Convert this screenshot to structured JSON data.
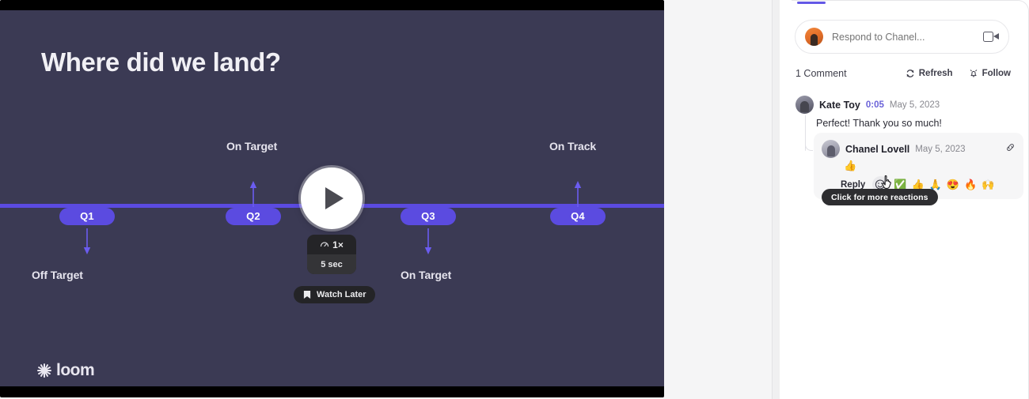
{
  "video": {
    "slide": {
      "title": "Where did we land?",
      "timeline": {
        "quarters": [
          "Q1",
          "Q2",
          "Q3",
          "Q4"
        ],
        "labels": [
          {
            "text": "Off Target",
            "quarter": "Q1",
            "direction": "down"
          },
          {
            "text": "On Target",
            "quarter": "Q2",
            "direction": "up"
          },
          {
            "text": "On Target",
            "quarter": "Q3",
            "direction": "down"
          },
          {
            "text": "On Track",
            "quarter": "Q4",
            "direction": "up"
          }
        ],
        "accent_color": "#5b4be0"
      },
      "background_color": "#3b3a54",
      "brand": "loom"
    },
    "controls": {
      "play_label": "Play",
      "play_icon": "play-triangle-icon",
      "speed": "1×",
      "speed_icon": "playback-speed-icon",
      "duration": "5 sec",
      "watch_later": "Watch Later",
      "watch_later_icon": "bookmark-icon"
    }
  },
  "panel": {
    "active_tab_indicator_color": "#6358e6",
    "composer": {
      "placeholder": "Respond to Chanel...",
      "value": "",
      "avatar": "chanel-avatar",
      "record_icon": "video-camera-icon"
    },
    "meta": {
      "comment_count": "1 Comment",
      "refresh_label": "Refresh",
      "refresh_icon": "refresh-icon",
      "follow_label": "Follow",
      "follow_icon": "bell-icon"
    },
    "comments": [
      {
        "author": "Kate Toy",
        "timestamp": "0:05",
        "date": "May 5, 2023",
        "body": "Perfect! Thank you so much!",
        "avatar": "kate-avatar"
      }
    ],
    "reply": {
      "author": "Chanel Lovell",
      "date": "May 5, 2023",
      "emoji": "👍",
      "avatar": "chanel-lovell-avatar",
      "link_icon": "copy-link-icon",
      "reply_label": "Reply",
      "picker_icon": "add-reaction-smiley-icon",
      "quick_reactions": [
        "✅",
        "👍",
        "🙏",
        "😍",
        "🔥",
        "🙌"
      ]
    },
    "tooltip": "Click for more reactions"
  }
}
